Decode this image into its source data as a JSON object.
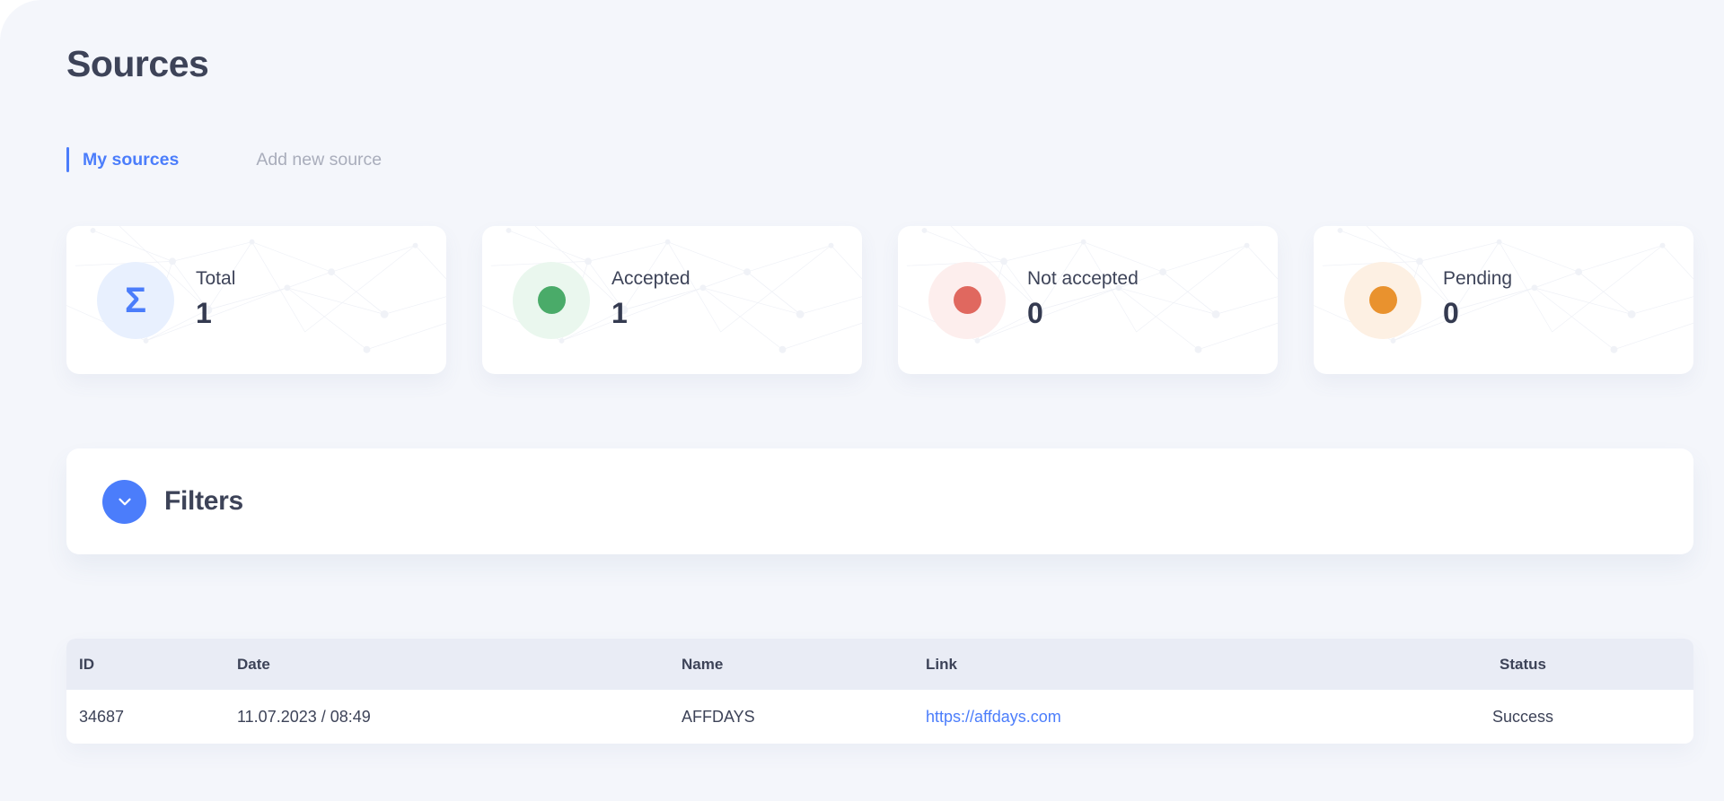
{
  "header": {
    "title": "Sources"
  },
  "tabs": [
    {
      "label": "My sources",
      "active": true
    },
    {
      "label": "Add new source",
      "active": false
    }
  ],
  "stat_cards": [
    {
      "label": "Total",
      "value": "1",
      "icon": "sigma-icon",
      "icon_glyph": "Σ",
      "badge_bg": "#e8f0fe",
      "accent": "#4b7dfb"
    },
    {
      "label": "Accepted",
      "value": "1",
      "icon": "status-dot-green",
      "badge_bg": "#eaf7ee",
      "accent": "#4aab69"
    },
    {
      "label": "Not accepted",
      "value": "0",
      "icon": "status-dot-red",
      "badge_bg": "#fdeeed",
      "accent": "#e0685f"
    },
    {
      "label": "Pending",
      "value": "0",
      "icon": "status-dot-orange",
      "badge_bg": "#fdf0e3",
      "accent": "#e9922e"
    }
  ],
  "filters": {
    "label": "Filters",
    "toggle_icon": "chevron-down-icon",
    "expanded": false
  },
  "table": {
    "columns": [
      "ID",
      "Date",
      "Name",
      "Link",
      "Status"
    ],
    "rows": [
      {
        "id": "34687",
        "date": "11.07.2023 / 08:49",
        "name": "AFFDAYS",
        "link": "https://affdays.com",
        "status": "Success"
      }
    ]
  },
  "colors": {
    "page_bg": "#f4f6fb",
    "card_bg": "#ffffff",
    "accent_blue": "#4b7dfb",
    "text_dark": "#3d4358",
    "text_muted": "#a9adbb",
    "table_header_bg": "#e9ecf5"
  }
}
